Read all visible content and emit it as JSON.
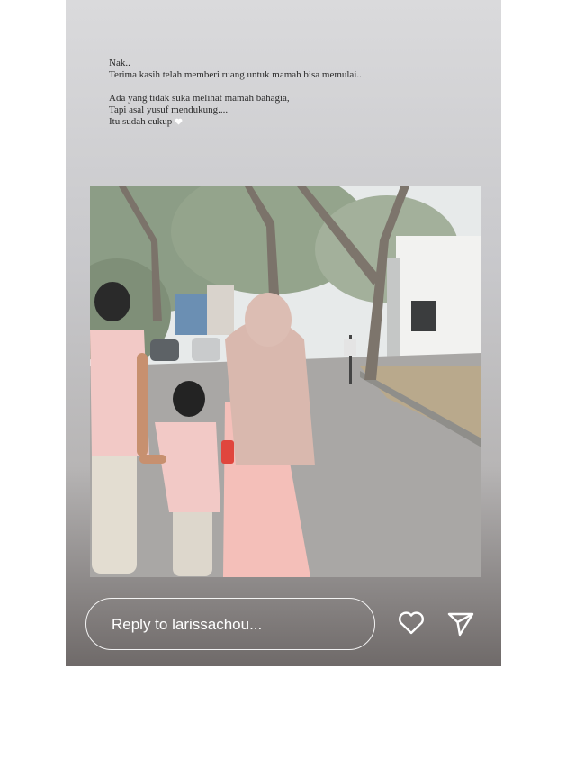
{
  "caption": {
    "line1": "Nak..",
    "line2": "Terima kasih telah memberi ruang untuk mamah bisa memulai..",
    "line3": "Ada yang tidak suka melihat mamah bahagia,",
    "line4": "Tapi asal yusuf mendukung....",
    "line5": "Itu sudah cukup"
  },
  "mention": "@larissachou",
  "reply": {
    "placeholder": "Reply to larissachou..."
  },
  "icons": {
    "like": "heart-icon",
    "send": "send-icon",
    "emoji": "white-heart-emoji"
  },
  "colors": {
    "clothing": "#f2c9c6",
    "hijab": "#d8b6ac",
    "road": "#a9a7a5"
  }
}
